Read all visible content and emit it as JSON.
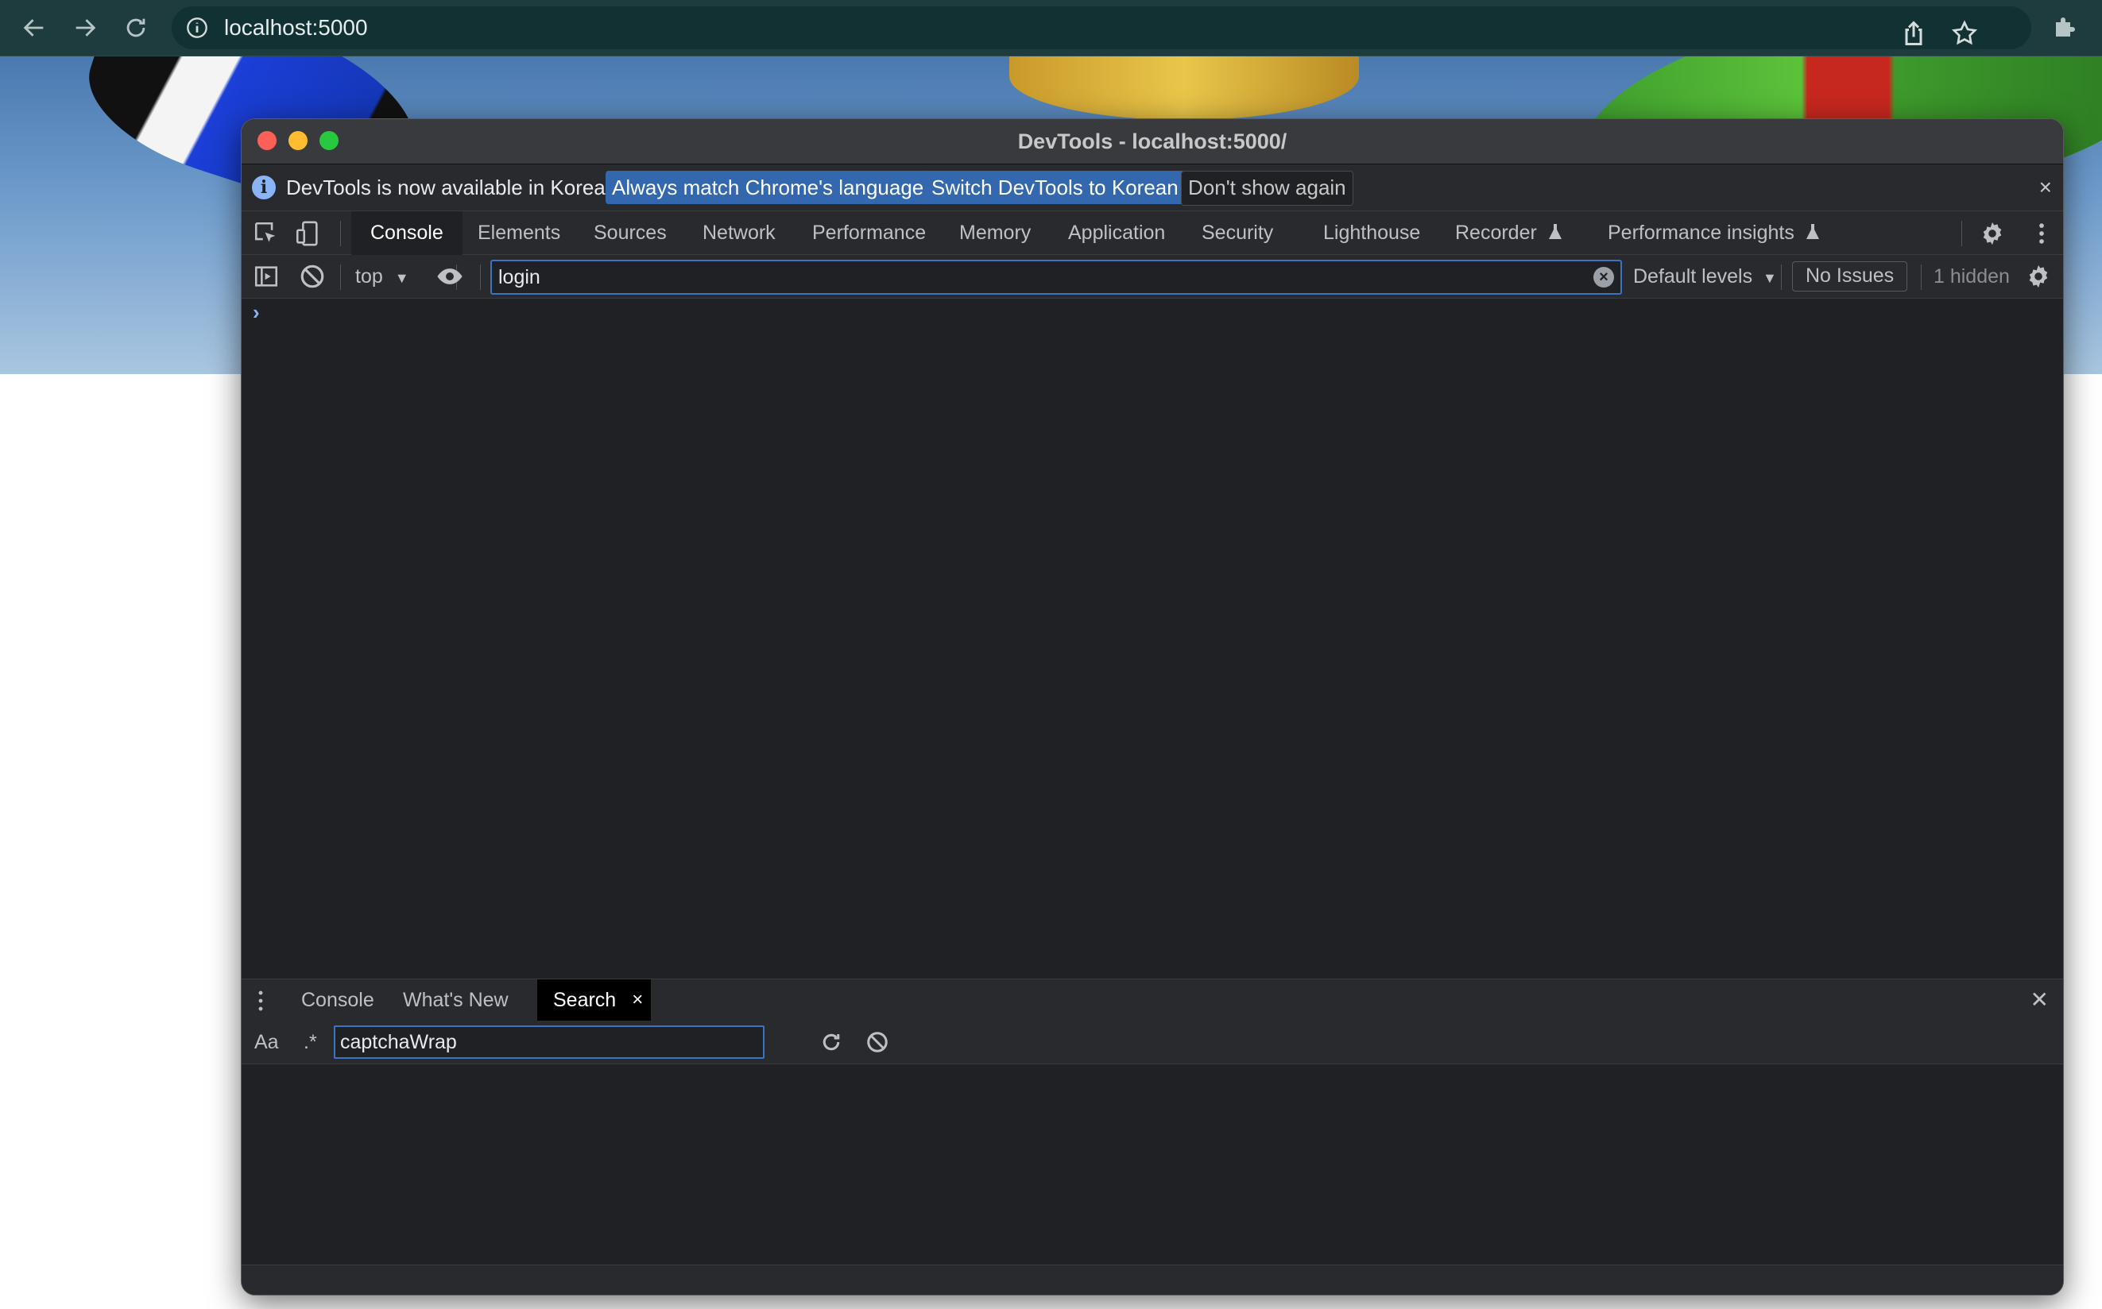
{
  "browser": {
    "url": "localhost:5000",
    "icons": {
      "back": "arrow-left-icon",
      "forward": "arrow-right-icon",
      "reload": "reload-icon",
      "info": "info-icon",
      "share": "share-icon",
      "bookmark": "star-icon",
      "extensions": "puzzle-icon"
    }
  },
  "devtools": {
    "title": "DevTools - localhost:5000/",
    "infobar": {
      "message": "DevTools is now available in Korean!",
      "always_match": "Always match Chrome's language",
      "switch_korean": "Switch DevTools to Korean",
      "dont_show": "Don't show again",
      "close": "×"
    },
    "tabs": [
      {
        "label": "Console",
        "active": true
      },
      {
        "label": "Elements"
      },
      {
        "label": "Sources"
      },
      {
        "label": "Network"
      },
      {
        "label": "Performance"
      },
      {
        "label": "Memory"
      },
      {
        "label": "Application"
      },
      {
        "label": "Security"
      },
      {
        "label": "Lighthouse"
      },
      {
        "label": "Recorder"
      },
      {
        "label": "Performance insights"
      }
    ],
    "console_toolbar": {
      "context": "top",
      "filter_value": "login",
      "levels": "Default levels",
      "issues": "No Issues",
      "hidden": "1 hidden"
    },
    "prompt": "›",
    "drawer": {
      "tabs": [
        {
          "label": "Console"
        },
        {
          "label": "What's New"
        },
        {
          "label": "Search",
          "active": true,
          "close": "×"
        }
      ],
      "close": "✕",
      "case_toggle": "Aa",
      "regex_toggle": ".*",
      "search_value": "captchaWrap"
    },
    "colors": {
      "background": "#202124",
      "toolbar": "#292a2d",
      "accent": "#3367ae",
      "focus": "#3d73c4"
    }
  }
}
